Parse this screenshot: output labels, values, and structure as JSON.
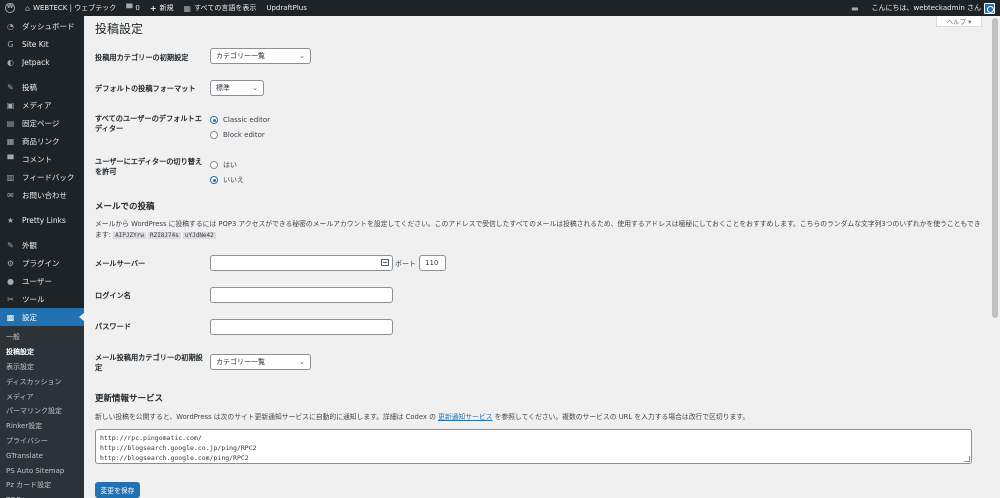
{
  "adminbar": {
    "site_name": "WEBTECK | ウェブテック",
    "comments_count": "0",
    "new_label": "新規",
    "show_all_languages": "すべての言語を表示",
    "updraft": "UpdraftPlus",
    "greeting": "こんにちは、webteckadmin さん"
  },
  "sidebar": {
    "items": [
      {
        "label": "ダッシュボード",
        "icon": "dashboard-icon",
        "glyph": "◔"
      },
      {
        "label": "Site Kit",
        "icon": "sitekit-icon",
        "glyph": "G"
      },
      {
        "label": "Jetpack",
        "icon": "jetpack-icon",
        "glyph": "◐"
      },
      {
        "label": "投稿",
        "icon": "pin-icon",
        "glyph": "✎"
      },
      {
        "label": "メディア",
        "icon": "media-icon",
        "glyph": "▣"
      },
      {
        "label": "固定ページ",
        "icon": "page-icon",
        "glyph": "▤"
      },
      {
        "label": "商品リンク",
        "icon": "product-icon",
        "glyph": "▦"
      },
      {
        "label": "コメント",
        "icon": "comment-icon",
        "glyph": "▀"
      },
      {
        "label": "フィードバック",
        "icon": "feedback-icon",
        "glyph": "▥"
      },
      {
        "label": "お問い合わせ",
        "icon": "mail-icon",
        "glyph": "✉"
      },
      {
        "label": "Pretty Links",
        "icon": "pretty-links-icon",
        "glyph": "★"
      },
      {
        "label": "外観",
        "icon": "appearance-icon",
        "glyph": "✎"
      },
      {
        "label": "プラグイン",
        "icon": "plugin-icon",
        "glyph": "⚙"
      },
      {
        "label": "ユーザー",
        "icon": "user-icon",
        "glyph": "●"
      },
      {
        "label": "ツール",
        "icon": "tool-icon",
        "glyph": "✂"
      },
      {
        "label": "設定",
        "icon": "settings-icon",
        "glyph": "▩"
      }
    ],
    "submenu": [
      "一般",
      "投稿設定",
      "表示設定",
      "ディスカッション",
      "メディア",
      "パーマリンク設定",
      "Rinker設定",
      "プライバシー",
      "GTranslate",
      "PS Auto Sitemap",
      "Pz カード設定",
      "TOC+"
    ]
  },
  "help_tab": "ヘルプ ▾",
  "page_title": "投稿設定",
  "writing": {
    "default_category_label": "投稿用カテゴリーの初期設定",
    "default_category_value": "カテゴリー一覧",
    "default_format_label": "デフォルトの投稿フォーマット",
    "default_format_value": "標準",
    "default_editor_label": "すべてのユーザーのデフォルトエディター",
    "editor_classic": "Classic editor",
    "editor_block": "Block editor",
    "allow_switch_label": "ユーザーにエディターの切り替えを許可",
    "switch_yes": "はい",
    "switch_no": "いいえ"
  },
  "post_via_email": {
    "title": "メールでの投稿",
    "description": "メールから WordPress に投稿するには POP3 アクセスができる秘密のメールアカウントを設定してください。このアドレスで受信したすべてのメールは投稿されるため、使用するアドレスは極秘にしておくことをおすすめします。こちらのランダムな文字列3つのいずれかを使うこともできます:",
    "codes": [
      "AIPJZYrw",
      "RZI8J74s",
      "uYJdNe42"
    ],
    "mail_server_label": "メールサーバー",
    "mail_server_value": "",
    "port_label": "ポート",
    "port_value": "110",
    "login_label": "ログイン名",
    "login_value": "",
    "password_label": "パスワード",
    "password_value": "",
    "category_label": "メール投稿用カテゴリーの初期設定",
    "category_value": "カテゴリー一覧"
  },
  "update_services": {
    "title": "更新情報サービス",
    "desc_before": "新しい投稿を公開すると、WordPress は次のサイト更新通知サービスに自動的に通知します。詳細は Codex の",
    "desc_link": "更新通知サービス",
    "desc_after": "を参照してください。複数のサービスの URL を入力する場合は改行で区切ります。",
    "urls": [
      "http://rpc.pingomatic.com/",
      "http://blogsearch.google.co.jp/ping/RPC2",
      "http://blogsearch.google.com/ping/RPC2"
    ]
  },
  "save_button": "変更を保存",
  "colors": {
    "accent": "#2271b1",
    "sidebar_bg": "#1d2327",
    "page_bg": "#f0f0f1"
  }
}
